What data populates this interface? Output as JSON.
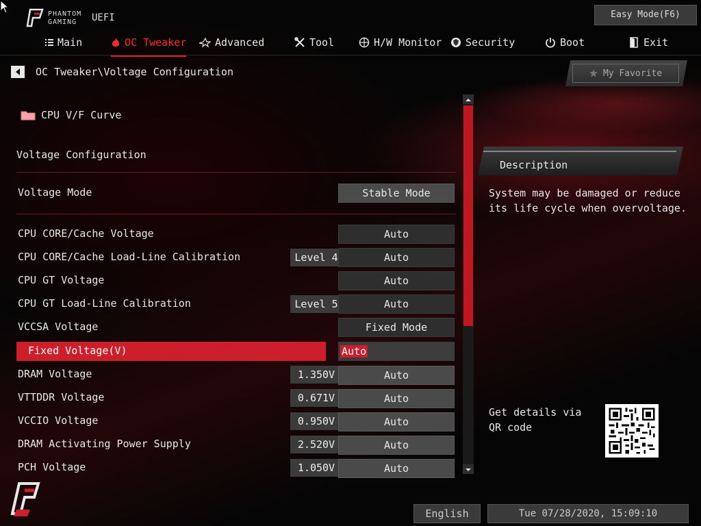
{
  "brand": {
    "line1": "PHANTOM",
    "line2": "GAMING",
    "uefi": "UEFI"
  },
  "easy_mode": "Easy Mode(F6)",
  "nav": [
    {
      "label": "Main",
      "icon": "list-icon"
    },
    {
      "label": "OC Tweaker",
      "icon": "flame-icon",
      "active": true
    },
    {
      "label": "Advanced",
      "icon": "star-icon"
    },
    {
      "label": "Tool",
      "icon": "tools-icon"
    },
    {
      "label": "H/W Monitor",
      "icon": "crosshair-icon"
    },
    {
      "label": "Security",
      "icon": "shield-icon"
    },
    {
      "label": "Boot",
      "icon": "power-icon"
    },
    {
      "label": "Exit",
      "icon": "exit-door-icon"
    }
  ],
  "breadcrumb": "OC Tweaker\\Voltage Configuration",
  "favorite": "My Favorite",
  "folder": "CPU V/F Curve",
  "section": "Voltage Configuration",
  "rows": [
    {
      "label": "Voltage Mode",
      "tag": "",
      "value": "Stable Mode"
    },
    {
      "label": "CPU CORE/Cache Voltage",
      "tag": "",
      "value": "Auto"
    },
    {
      "label": "CPU CORE/Cache Load-Line Calibration",
      "tag": "Level 4",
      "value": "Auto"
    },
    {
      "label": "CPU GT Voltage",
      "tag": "",
      "value": "Auto"
    },
    {
      "label": "CPU GT Load-Line Calibration",
      "tag": "Level 5",
      "value": "Auto"
    },
    {
      "label": "VCCSA Voltage",
      "tag": "",
      "value": "Fixed Mode"
    },
    {
      "label": "Fixed Voltage(V)",
      "tag": "",
      "value": "Auto"
    },
    {
      "label": "DRAM Voltage",
      "tag": "1.350V",
      "value": "Auto"
    },
    {
      "label": "VTTDDR Voltage",
      "tag": "0.671V",
      "value": "Auto"
    },
    {
      "label": "VCCIO Voltage",
      "tag": "0.950V",
      "value": "Auto"
    },
    {
      "label": "DRAM Activating Power Supply",
      "tag": "2.520V",
      "value": "Auto"
    },
    {
      "label": "PCH Voltage",
      "tag": "1.050V",
      "value": "Auto"
    }
  ],
  "description": {
    "title": "Description",
    "text": "System may be damaged or reduce its life cycle when overvoltage.",
    "qr_text": "Get details via QR code"
  },
  "footer": {
    "language": "English",
    "datetime": "Tue 07/28/2020, 15:09:10"
  },
  "colors": {
    "accent": "#cc1f2b",
    "background": "#050505"
  }
}
